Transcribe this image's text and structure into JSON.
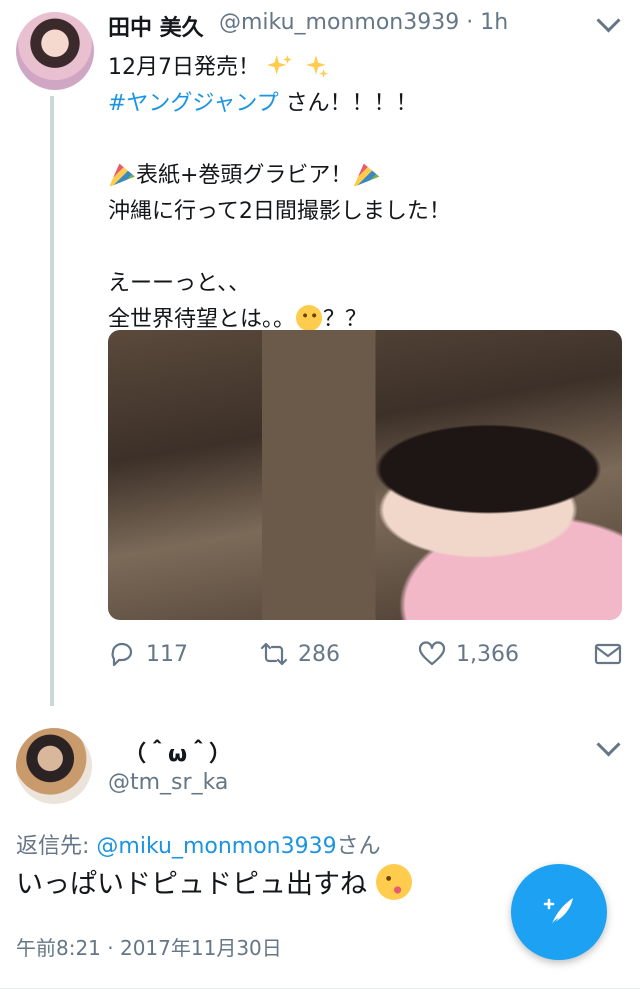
{
  "tweet": {
    "author_name": "田中 美久",
    "author_handle": "@miku_monmon3939",
    "time_sep": "·",
    "time_ago": "1h",
    "line1_text": "12月7日発売！",
    "line2_hashtag": "#ヤングジャンプ",
    "line2_rest": " さん！！！！",
    "line3_text": "表紙+巻頭グラビア！",
    "line4_text": "沖縄に行って2日間撮影しました！",
    "line5_text": "えーーっと、、",
    "line6_before": "全世界待望とは。。",
    "line6_after": "？？",
    "stats": {
      "replies": "117",
      "retweets": "286",
      "likes": "1,366"
    }
  },
  "reply": {
    "author_name": "（＾ω＾）",
    "author_handle": "@tm_sr_ka",
    "reply_to_label": "返信先: ",
    "reply_to_handle": "@miku_monmon3939",
    "reply_to_suffix": "さん",
    "text": "いっぱいドピュドピュ出すね",
    "timestamp": "午前8:21 · 2017年11月30日"
  },
  "colors": {
    "accent": "#1da1f2",
    "link": "#1b95e0",
    "secondary_text": "#657786"
  },
  "icons": [
    "reply-icon",
    "retweet-icon",
    "like-icon",
    "direct-message-icon",
    "compose-icon",
    "chevron-down-icon",
    "sparkles-icon",
    "party-popper-icon",
    "thinking-face-icon",
    "kissing-face-icon"
  ]
}
